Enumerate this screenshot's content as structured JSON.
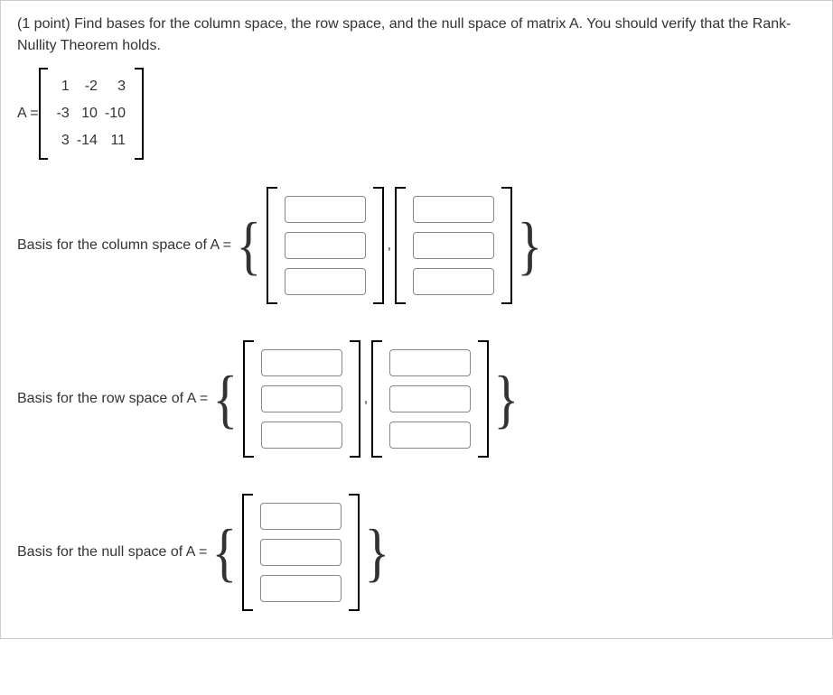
{
  "question": {
    "points_prefix": "(1 point) ",
    "text": "Find bases for the column space, the row space, and the null space of matrix A. You should verify that the Rank-Nullity Theorem holds."
  },
  "matrix": {
    "label": "A = ",
    "rows": [
      [
        "1",
        "-2",
        "3"
      ],
      [
        "-3",
        "10",
        "-10"
      ],
      [
        "3",
        "-14",
        "11"
      ]
    ]
  },
  "answers": {
    "col_space": {
      "label": "Basis for the column space of A = ",
      "vectors": [
        {
          "cells": [
            "",
            "",
            ""
          ]
        },
        {
          "cells": [
            "",
            "",
            ""
          ]
        }
      ]
    },
    "row_space": {
      "label": "Basis for the row space of A = ",
      "vectors": [
        {
          "cells": [
            "",
            "",
            ""
          ]
        },
        {
          "cells": [
            "",
            "",
            ""
          ]
        }
      ]
    },
    "null_space": {
      "label": "Basis for the null space of A = ",
      "vectors": [
        {
          "cells": [
            "",
            "",
            ""
          ]
        }
      ]
    }
  },
  "glyphs": {
    "open_curly": "{",
    "close_curly": "}",
    "comma": ","
  }
}
